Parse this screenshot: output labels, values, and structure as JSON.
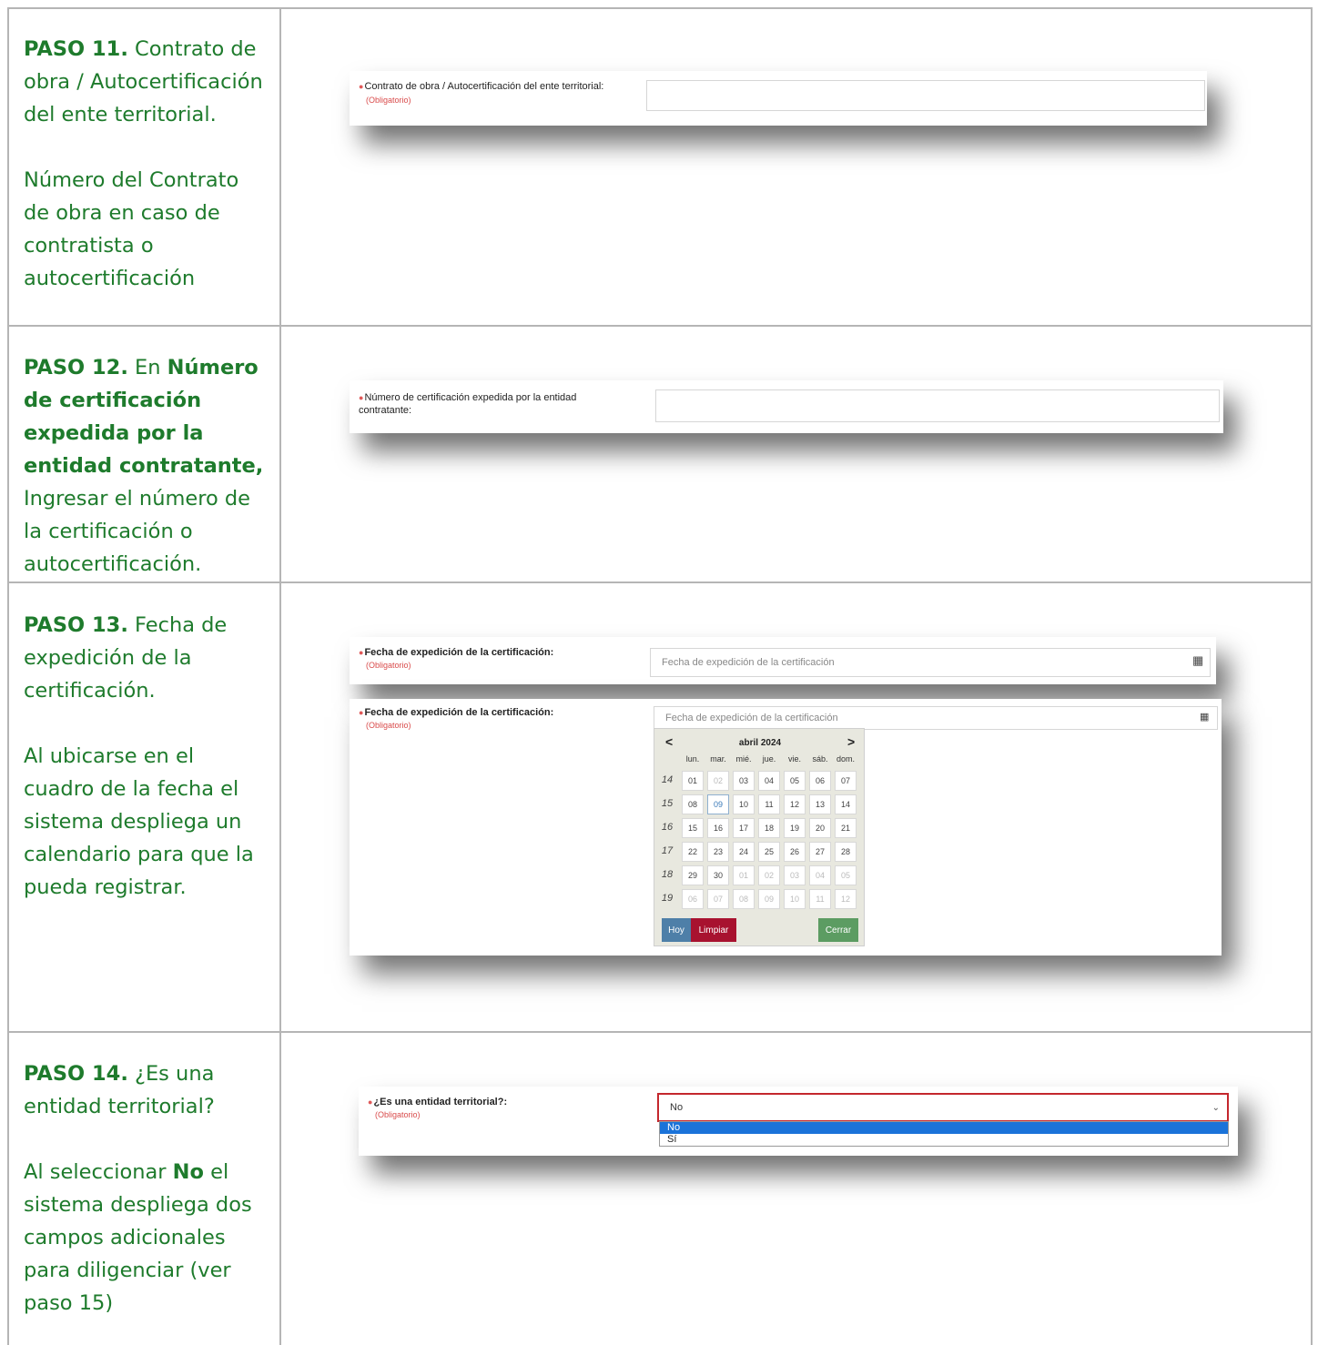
{
  "step11": {
    "heading": "PASO 11.",
    "text_a": " Contrato de obra / Autocertificación del ente territorial.",
    "text_b": "Número del Contrato de obra en caso de contratista o autocertificación",
    "field_label": "Contrato de obra / Autocertificación del ente territorial:",
    "required": "(Obligatorio)",
    "field_value": ""
  },
  "step12": {
    "heading": "PASO 12.",
    "text_en": " En ",
    "text_bold": "Número de certificación expedida por la entidad contratante,",
    "text_rest": " Ingresar el número de la certificación o autocertificación.",
    "field_label_1": "Número de certificación expedida por la entidad",
    "field_label_2": "contratante:",
    "field_value": ""
  },
  "step13": {
    "heading": "PASO 13.",
    "text_a": " Fecha de expedición de la certificación.",
    "text_b": "Al ubicarse en el cuadro de la fecha el sistema despliega un calendario para que la pueda registrar.",
    "field_label": "Fecha de expedición de la certificación:",
    "required": "(Obligatorio)",
    "placeholder": "Fecha de expedición de la certificación",
    "calendar": {
      "month": "abril 2024",
      "prev": "<",
      "next": ">",
      "weekdays": [
        "lun.",
        "mar.",
        "mié.",
        "jue.",
        "vie.",
        "sáb.",
        "dom."
      ],
      "weeks": [
        {
          "num": "14",
          "days": [
            "01",
            "02",
            "03",
            "04",
            "05",
            "06",
            "07"
          ]
        },
        {
          "num": "15",
          "days": [
            "08",
            "09",
            "10",
            "11",
            "12",
            "13",
            "14"
          ]
        },
        {
          "num": "16",
          "days": [
            "15",
            "16",
            "17",
            "18",
            "19",
            "20",
            "21"
          ]
        },
        {
          "num": "17",
          "days": [
            "22",
            "23",
            "24",
            "25",
            "26",
            "27",
            "28"
          ]
        },
        {
          "num": "18",
          "days": [
            "29",
            "30",
            "01",
            "02",
            "03",
            "04",
            "05"
          ]
        },
        {
          "num": "19",
          "days": [
            "06",
            "07",
            "08",
            "09",
            "10",
            "11",
            "12"
          ]
        }
      ],
      "today_label": "Hoy",
      "clear_label": "Limpiar",
      "close_label": "Cerrar"
    }
  },
  "step14": {
    "heading": "PASO 14.",
    "text_a": "  ¿Es una entidad territorial?",
    "text_b_1": "Al seleccionar ",
    "text_b_bold": "No",
    "text_b_2": " el sistema despliega dos campos adicionales para diligenciar (ver paso 15)",
    "field_label": "¿Es una entidad territorial?:",
    "required": "(Obligatorio)",
    "selected": "No",
    "options": [
      "No",
      "Sí"
    ]
  },
  "colors": {
    "text_green": "#1e7b2c",
    "required_red": "#d94b4b",
    "select_border": "#c4272d",
    "option_blue": "#1a73d9"
  }
}
